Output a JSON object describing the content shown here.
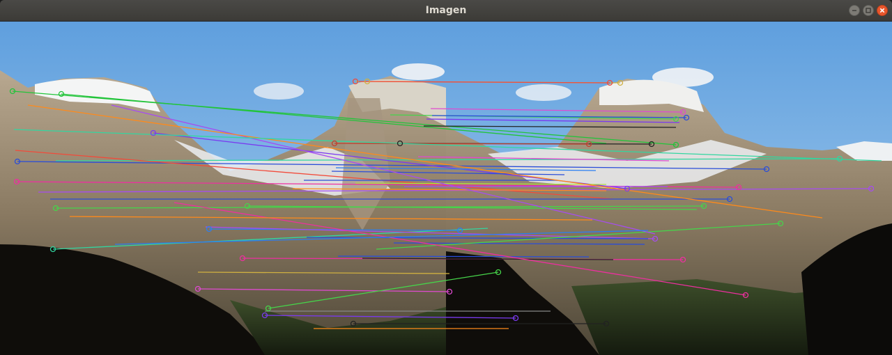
{
  "window": {
    "title": "Imagen",
    "controls": [
      "minimize-icon",
      "maximize-icon",
      "close-icon"
    ],
    "accent_close": "#e9562b"
  },
  "image": {
    "description_icons": [
      "left-photo",
      "right-photo",
      "match-lines",
      "keypoint-circles"
    ],
    "match_colors": [
      "#22c43a",
      "#a64df0",
      "#ff8a1a",
      "#2a4dd8",
      "#e04ad0",
      "#32d6a0",
      "#f24a3a",
      "#7a3af0",
      "#b0e040",
      "#2b7ff2",
      "#ee2fa0",
      "#d0b040",
      "#222222",
      "#888888",
      "#c0402f",
      "#46d44a"
    ]
  }
}
